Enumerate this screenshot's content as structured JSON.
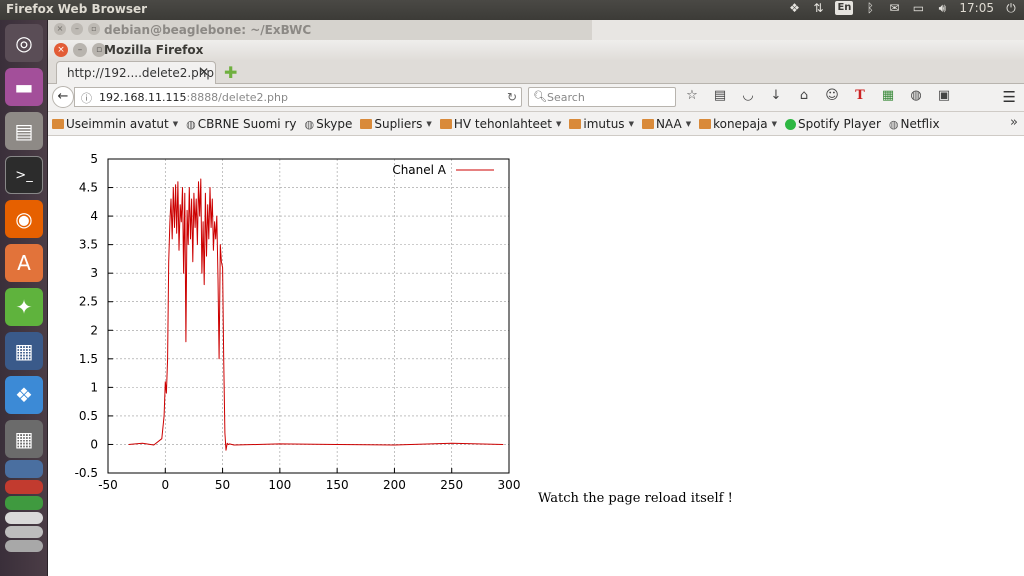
{
  "topbar": {
    "title": "Firefox Web Browser",
    "keyboard": "En",
    "clock": "17:05",
    "tray_icons": [
      "dropbox-icon",
      "network-arrows-icon",
      "keyboard-layout-icon",
      "bluetooth-icon",
      "mail-icon",
      "battery-icon",
      "volume-icon",
      "clock",
      "power-icon"
    ]
  },
  "launcher": {
    "items": [
      "ubuntu-dash",
      "files-app",
      "file-cabinet",
      "terminal",
      "firefox",
      "software-center",
      "settings",
      "workspace-switcher",
      "dropbox",
      "calculator",
      "stacked-apps"
    ]
  },
  "background_window": {
    "title": "debian@beaglebone: ~/ExBWC"
  },
  "firefox": {
    "window_title": "Mozilla Firefox",
    "tab_label": "http://192....delete2.php",
    "url_host": "192.168.11.115",
    "url_rest": ":8888/delete2.php",
    "search_placeholder": "Search",
    "bookmarks": [
      {
        "label": "Useimmin avatut",
        "icon": "folder",
        "dropdown": true
      },
      {
        "label": "CBRNE Suomi ry",
        "icon": "globe",
        "dropdown": false
      },
      {
        "label": "Skype",
        "icon": "globe",
        "dropdown": false
      },
      {
        "label": "Supliers",
        "icon": "folder",
        "dropdown": true
      },
      {
        "label": "HV tehonlahteet",
        "icon": "folder",
        "dropdown": true
      },
      {
        "label": "imutus",
        "icon": "folder",
        "dropdown": true
      },
      {
        "label": "NAA",
        "icon": "folder",
        "dropdown": true
      },
      {
        "label": "konepaja",
        "icon": "folder",
        "dropdown": true
      },
      {
        "label": "Spotify Player",
        "icon": "spotify",
        "dropdown": false
      },
      {
        "label": "Netflix",
        "icon": "globe",
        "dropdown": false
      }
    ]
  },
  "page": {
    "caption": "Watch the page reload itself !"
  },
  "chart_data": {
    "type": "line",
    "title": "",
    "xlabel": "",
    "ylabel": "",
    "xlim": [
      -50,
      300
    ],
    "ylim": [
      -0.5,
      5
    ],
    "xticks": [
      -50,
      0,
      50,
      100,
      150,
      200,
      250,
      300
    ],
    "yticks": [
      -0.5,
      0,
      0.5,
      1,
      1.5,
      2,
      2.5,
      3,
      3.5,
      4,
      4.5,
      5
    ],
    "grid": true,
    "legend_position": "top-right",
    "series": [
      {
        "name": "Chanel A",
        "color": "#cc0000",
        "x": [
          -32,
          -20,
          -10,
          -3,
          -1,
          0,
          1,
          2,
          3,
          4,
          5,
          6,
          7,
          8,
          9,
          10,
          11,
          12,
          13,
          14,
          15,
          16,
          17,
          18,
          19,
          20,
          21,
          22,
          23,
          24,
          25,
          26,
          27,
          28,
          29,
          30,
          31,
          32,
          33,
          34,
          35,
          36,
          37,
          38,
          39,
          40,
          41,
          42,
          43,
          44,
          45,
          46,
          47,
          48,
          49,
          50,
          51,
          52,
          53,
          54,
          55,
          56,
          60,
          80,
          100,
          150,
          200,
          250,
          295
        ],
        "y": [
          0,
          0.02,
          -0.01,
          0.1,
          0.5,
          1.1,
          0.9,
          1.5,
          3.2,
          3.9,
          4.3,
          3.6,
          4.5,
          3.8,
          4.55,
          3.7,
          4.6,
          3.4,
          4.2,
          3.9,
          4.5,
          3.0,
          4.4,
          1.8,
          4.1,
          3.5,
          4.5,
          3.6,
          4.3,
          3.2,
          4.4,
          3.8,
          4.3,
          3.5,
          4.6,
          4.0,
          4.65,
          3.0,
          3.9,
          2.8,
          4.4,
          3.3,
          4.2,
          3.6,
          4.5,
          3.8,
          4.3,
          3.4,
          3.9,
          3.6,
          4.0,
          2.9,
          1.5,
          3.5,
          3.2,
          3.1,
          1.5,
          0.2,
          -0.1,
          0.02,
          0.0,
          0.01,
          -0.01,
          0.0,
          0.01,
          0.0,
          -0.01,
          0.02,
          0.0
        ]
      }
    ]
  }
}
